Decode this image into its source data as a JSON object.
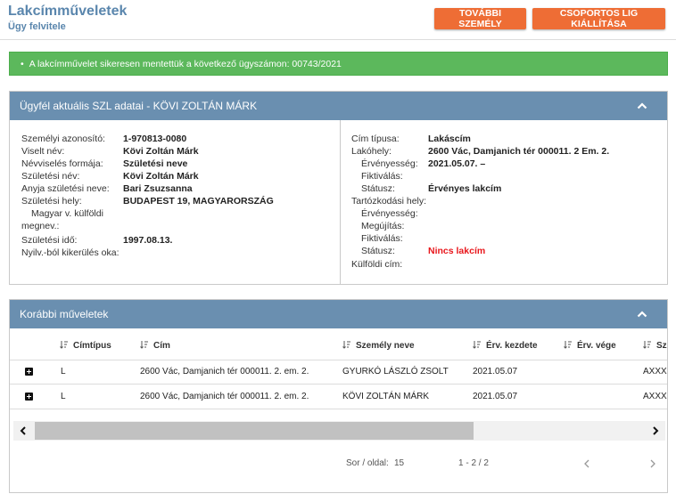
{
  "header": {
    "title": "Lakcímműveletek",
    "subtitle": "Ügy felvitele",
    "btn_more": "TOVÁBBI SZEMÉLY",
    "btn_group": "CSOPORTOS LIG KIÁLLÍTÁSA"
  },
  "alert": {
    "bullet": "•",
    "text": "A lakcímművelet sikeresen mentettük a következő ügyszámon: 00743/2021"
  },
  "client_panel": {
    "title": "Ügyfél aktuális SZL adatai - KÖVI ZOLTÁN MÁRK",
    "left": [
      {
        "label": "Személyi azonosító:",
        "value": "1-970813-0080"
      },
      {
        "label": "Viselt név:",
        "value": "Kövi Zoltán Márk"
      },
      {
        "label": "Névviselés formája:",
        "value": "Születési neve"
      },
      {
        "label": "Születési név:",
        "value": "Kövi Zoltán Márk"
      },
      {
        "label": "Anyja születési neve:",
        "value": "Bari Zsuzsanna"
      },
      {
        "label": "Születési hely:",
        "value": "BUDAPEST 19, MAGYARORSZÁG"
      },
      {
        "label": "Magyar v. külföldi",
        "value": ""
      },
      {
        "label": "megnev.:",
        "value": ""
      },
      {
        "label": "Születési idő:",
        "value": "1997.08.13."
      },
      {
        "label": "Nyilv.-ból kikerülés oka:",
        "value": ""
      }
    ],
    "right": [
      {
        "label": "Cím típusa:",
        "value": "Lakáscím"
      },
      {
        "label": "Lakóhely:",
        "value": "2600 Vác, Damjanich tér 000011. 2 Em. 2."
      },
      {
        "label": "Érvényesség:",
        "value": "2021.05.07. –"
      },
      {
        "label": "Fiktiválás:",
        "value": ""
      },
      {
        "label": "Státusz:",
        "value": "Érvényes lakcím"
      },
      {
        "label": "Tartózkodási hely:",
        "value": ""
      },
      {
        "label": "Érvényesség:",
        "value": ""
      },
      {
        "label": "Megújítás:",
        "value": ""
      },
      {
        "label": "Fiktiválás:",
        "value": ""
      },
      {
        "label": "Státusz:",
        "value": "Nincs lakcím"
      },
      {
        "label": "Külföldi cím:",
        "value": ""
      }
    ]
  },
  "ops_panel": {
    "title": "Korábbi műveletek",
    "columns": [
      "Címtípus",
      "Cím",
      "Személy neve",
      "Érv. kezdete",
      "Érv. vége",
      "Sz"
    ],
    "rows": [
      {
        "type": "L",
        "address": "2600 Vác, Damjanich tér 000011. 2. em. 2.",
        "person": "GYURKÓ LÁSZLÓ ZSOLT",
        "start": "2021.05.07",
        "end": "",
        "extra": "AXXX"
      },
      {
        "type": "L",
        "address": "2600 Vác, Damjanich tér 000011. 2. em. 2.",
        "person": "KÖVI ZOLTÁN MÁRK",
        "start": "2021.05.07",
        "end": "",
        "extra": "AXXX"
      }
    ],
    "pager": {
      "rows_label": "Sor / oldal:",
      "rows_value": "15",
      "range": "1 - 2 / 2"
    }
  },
  "colors": {
    "accent_blue": "#5a86ad",
    "panel_header": "#6a8fb0",
    "button_orange": "#ee6d35",
    "alert_green": "#5cb85c",
    "error_red": "#e8161b"
  }
}
